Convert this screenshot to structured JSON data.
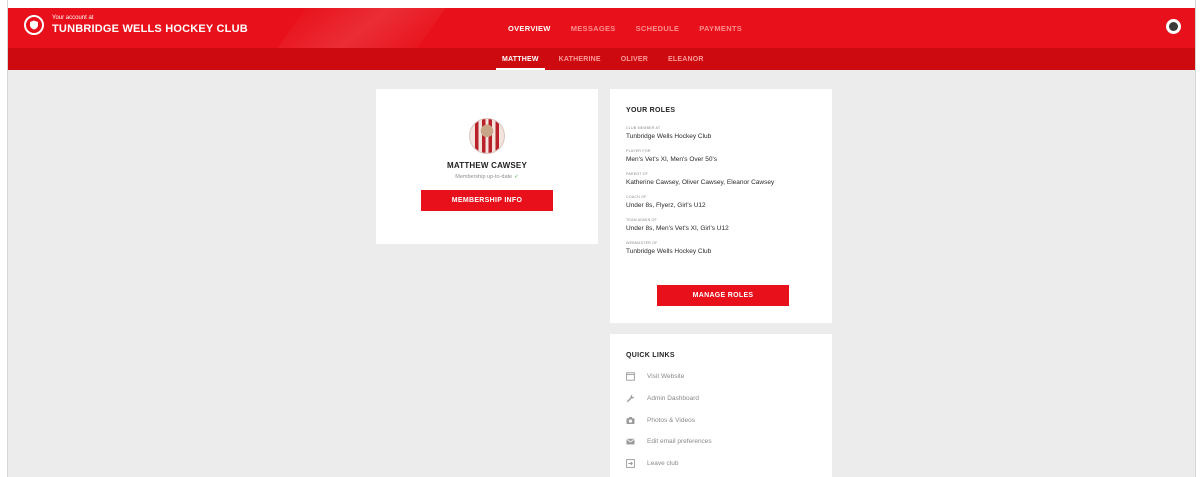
{
  "header": {
    "brand_sub": "Your account at",
    "brand_title": "TUNBRIDGE WELLS HOCKEY CLUB",
    "nav": [
      {
        "label": "OVERVIEW",
        "active": true
      },
      {
        "label": "MESSAGES",
        "active": false
      },
      {
        "label": "SCHEDULE",
        "active": false
      },
      {
        "label": "PAYMENTS",
        "active": false
      }
    ],
    "user_icon": "user-avatar-icon"
  },
  "subnav": [
    {
      "label": "MATTHEW",
      "active": true
    },
    {
      "label": "KATHERINE",
      "active": false
    },
    {
      "label": "OLIVER",
      "active": false
    },
    {
      "label": "ELEANOR",
      "active": false
    }
  ],
  "profile": {
    "name": "MATTHEW CAWSEY",
    "status": "Membership up-to-date",
    "status_tick": "✓",
    "button_label": "MEMBERSHIP INFO"
  },
  "roles": {
    "title": "YOUR ROLES",
    "groups": [
      {
        "label": "CLUB MEMBER AT",
        "value": "Tunbridge Wells Hockey Club"
      },
      {
        "label": "PLAYER FOR",
        "value": "Men's Vet's XI, Men's Over 50's"
      },
      {
        "label": "PARENT OF",
        "value": "Katherine Cawsey, Oliver Cawsey, Eleanor Cawsey"
      },
      {
        "label": "COACH OF",
        "value": "Under 8s, Flyerz, Girl's U12"
      },
      {
        "label": "TEAM ADMIN OF",
        "value": "Under 8s, Men's Vet's XI, Girl's U12"
      },
      {
        "label": "WEBMASTER OF",
        "value": "Tunbridge Wells Hockey Club"
      }
    ],
    "button_label": "MANAGE ROLES"
  },
  "quick_links": {
    "title": "QUICK LINKS",
    "items": [
      {
        "label": "Visit Website",
        "icon": "browser-window-icon"
      },
      {
        "label": "Admin Dashboard",
        "icon": "wrench-icon"
      },
      {
        "label": "Photos & Videos",
        "icon": "camera-icon"
      },
      {
        "label": "Edit email preferences",
        "icon": "envelope-icon"
      },
      {
        "label": "Leave club",
        "icon": "exit-icon"
      }
    ]
  },
  "colors": {
    "primary_red": "#e8101a",
    "subbar_red": "#cc0a10",
    "background": "#ececec"
  }
}
